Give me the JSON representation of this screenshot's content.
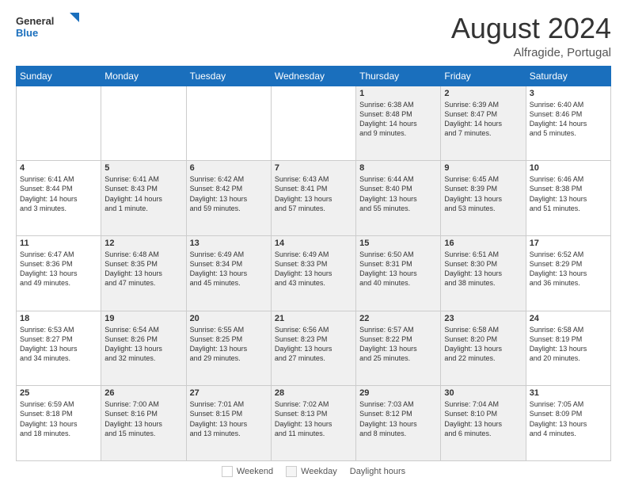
{
  "header": {
    "logo_general": "General",
    "logo_blue": "Blue",
    "month_year": "August 2024",
    "location": "Alfragide, Portugal"
  },
  "calendar": {
    "days_of_week": [
      "Sunday",
      "Monday",
      "Tuesday",
      "Wednesday",
      "Thursday",
      "Friday",
      "Saturday"
    ],
    "weeks": [
      [
        {
          "day": "",
          "info": ""
        },
        {
          "day": "",
          "info": ""
        },
        {
          "day": "",
          "info": ""
        },
        {
          "day": "",
          "info": ""
        },
        {
          "day": "1",
          "info": "Sunrise: 6:38 AM\nSunset: 8:48 PM\nDaylight: 14 hours\nand 9 minutes."
        },
        {
          "day": "2",
          "info": "Sunrise: 6:39 AM\nSunset: 8:47 PM\nDaylight: 14 hours\nand 7 minutes."
        },
        {
          "day": "3",
          "info": "Sunrise: 6:40 AM\nSunset: 8:46 PM\nDaylight: 14 hours\nand 5 minutes."
        }
      ],
      [
        {
          "day": "4",
          "info": "Sunrise: 6:41 AM\nSunset: 8:44 PM\nDaylight: 14 hours\nand 3 minutes."
        },
        {
          "day": "5",
          "info": "Sunrise: 6:41 AM\nSunset: 8:43 PM\nDaylight: 14 hours\nand 1 minute."
        },
        {
          "day": "6",
          "info": "Sunrise: 6:42 AM\nSunset: 8:42 PM\nDaylight: 13 hours\nand 59 minutes."
        },
        {
          "day": "7",
          "info": "Sunrise: 6:43 AM\nSunset: 8:41 PM\nDaylight: 13 hours\nand 57 minutes."
        },
        {
          "day": "8",
          "info": "Sunrise: 6:44 AM\nSunset: 8:40 PM\nDaylight: 13 hours\nand 55 minutes."
        },
        {
          "day": "9",
          "info": "Sunrise: 6:45 AM\nSunset: 8:39 PM\nDaylight: 13 hours\nand 53 minutes."
        },
        {
          "day": "10",
          "info": "Sunrise: 6:46 AM\nSunset: 8:38 PM\nDaylight: 13 hours\nand 51 minutes."
        }
      ],
      [
        {
          "day": "11",
          "info": "Sunrise: 6:47 AM\nSunset: 8:36 PM\nDaylight: 13 hours\nand 49 minutes."
        },
        {
          "day": "12",
          "info": "Sunrise: 6:48 AM\nSunset: 8:35 PM\nDaylight: 13 hours\nand 47 minutes."
        },
        {
          "day": "13",
          "info": "Sunrise: 6:49 AM\nSunset: 8:34 PM\nDaylight: 13 hours\nand 45 minutes."
        },
        {
          "day": "14",
          "info": "Sunrise: 6:49 AM\nSunset: 8:33 PM\nDaylight: 13 hours\nand 43 minutes."
        },
        {
          "day": "15",
          "info": "Sunrise: 6:50 AM\nSunset: 8:31 PM\nDaylight: 13 hours\nand 40 minutes."
        },
        {
          "day": "16",
          "info": "Sunrise: 6:51 AM\nSunset: 8:30 PM\nDaylight: 13 hours\nand 38 minutes."
        },
        {
          "day": "17",
          "info": "Sunrise: 6:52 AM\nSunset: 8:29 PM\nDaylight: 13 hours\nand 36 minutes."
        }
      ],
      [
        {
          "day": "18",
          "info": "Sunrise: 6:53 AM\nSunset: 8:27 PM\nDaylight: 13 hours\nand 34 minutes."
        },
        {
          "day": "19",
          "info": "Sunrise: 6:54 AM\nSunset: 8:26 PM\nDaylight: 13 hours\nand 32 minutes."
        },
        {
          "day": "20",
          "info": "Sunrise: 6:55 AM\nSunset: 8:25 PM\nDaylight: 13 hours\nand 29 minutes."
        },
        {
          "day": "21",
          "info": "Sunrise: 6:56 AM\nSunset: 8:23 PM\nDaylight: 13 hours\nand 27 minutes."
        },
        {
          "day": "22",
          "info": "Sunrise: 6:57 AM\nSunset: 8:22 PM\nDaylight: 13 hours\nand 25 minutes."
        },
        {
          "day": "23",
          "info": "Sunrise: 6:58 AM\nSunset: 8:20 PM\nDaylight: 13 hours\nand 22 minutes."
        },
        {
          "day": "24",
          "info": "Sunrise: 6:58 AM\nSunset: 8:19 PM\nDaylight: 13 hours\nand 20 minutes."
        }
      ],
      [
        {
          "day": "25",
          "info": "Sunrise: 6:59 AM\nSunset: 8:18 PM\nDaylight: 13 hours\nand 18 minutes."
        },
        {
          "day": "26",
          "info": "Sunrise: 7:00 AM\nSunset: 8:16 PM\nDaylight: 13 hours\nand 15 minutes."
        },
        {
          "day": "27",
          "info": "Sunrise: 7:01 AM\nSunset: 8:15 PM\nDaylight: 13 hours\nand 13 minutes."
        },
        {
          "day": "28",
          "info": "Sunrise: 7:02 AM\nSunset: 8:13 PM\nDaylight: 13 hours\nand 11 minutes."
        },
        {
          "day": "29",
          "info": "Sunrise: 7:03 AM\nSunset: 8:12 PM\nDaylight: 13 hours\nand 8 minutes."
        },
        {
          "day": "30",
          "info": "Sunrise: 7:04 AM\nSunset: 8:10 PM\nDaylight: 13 hours\nand 6 minutes."
        },
        {
          "day": "31",
          "info": "Sunrise: 7:05 AM\nSunset: 8:09 PM\nDaylight: 13 hours\nand 4 minutes."
        }
      ]
    ]
  },
  "footer": {
    "white_label": "Weekend",
    "gray_label": "Weekday",
    "daylight_label": "Daylight hours"
  }
}
